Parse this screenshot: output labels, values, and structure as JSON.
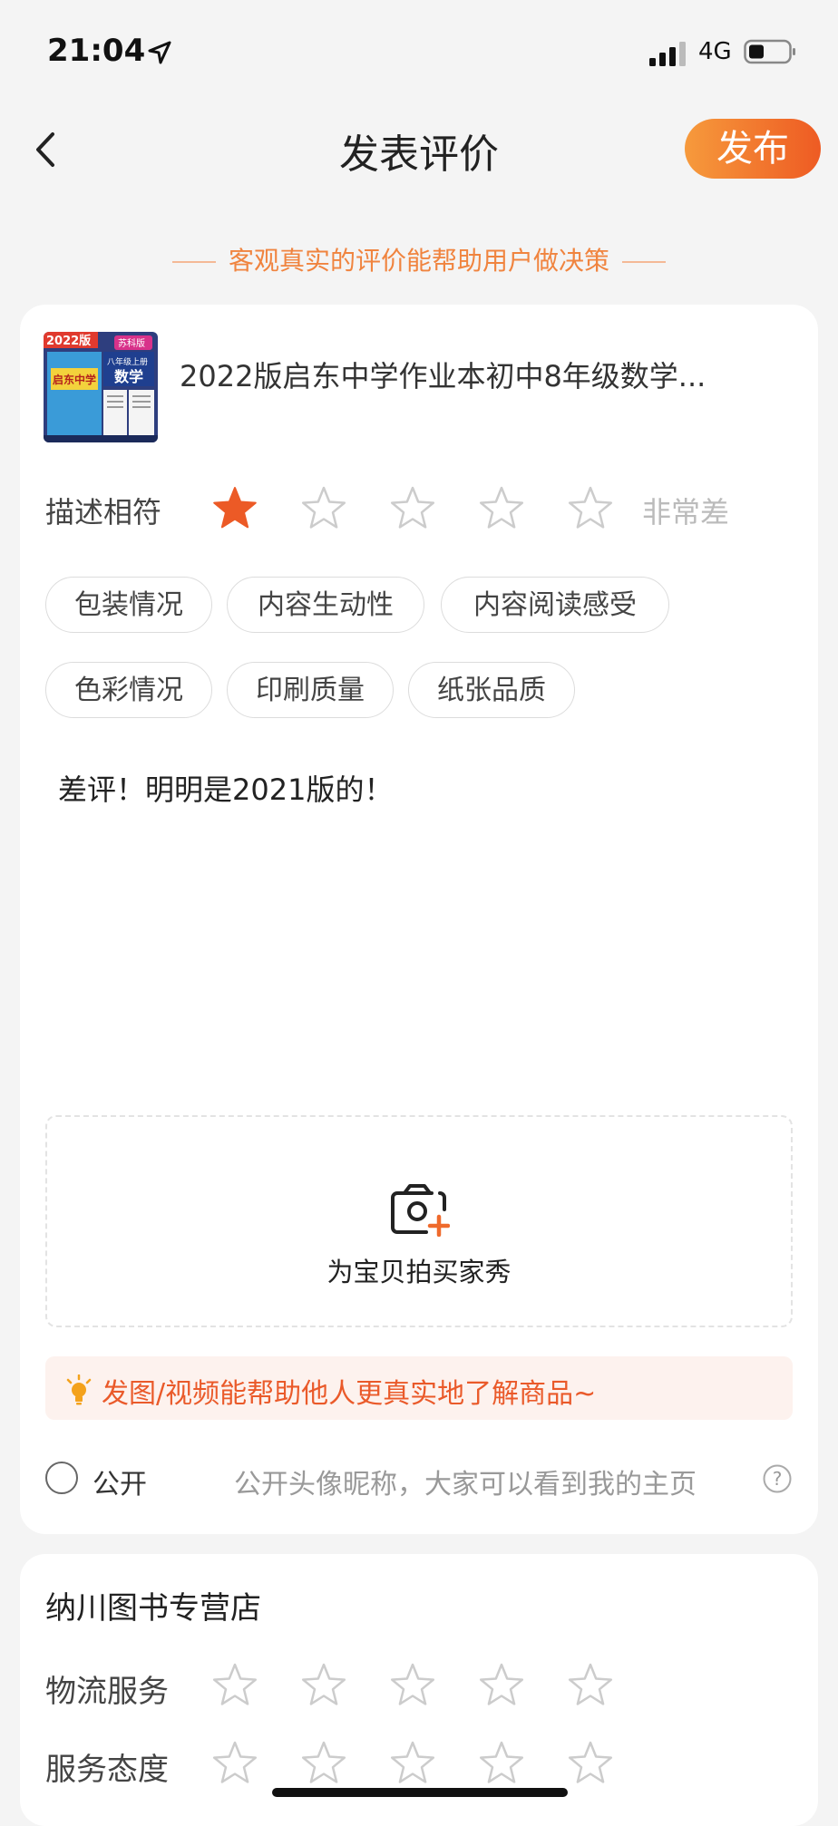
{
  "status_bar": {
    "time": "21:04",
    "network": "4G"
  },
  "header": {
    "title": "发表评价",
    "publish_label": "发布"
  },
  "tip": "客观真实的评价能帮助用户做决策",
  "product": {
    "title": "2022版启东中学作业本初中8年级数学...",
    "cover_texts": {
      "edition": "2022版",
      "version": "苏科版",
      "grade": "八年级上册",
      "subject": "数学",
      "brand": "启东中学"
    }
  },
  "rating": {
    "label": "描述相符",
    "value": 1,
    "max": 5,
    "text": "非常差"
  },
  "tags": [
    "包装情况",
    "内容生动性",
    "内容阅读感受",
    "色彩情况",
    "印刷质量",
    "纸张品质"
  ],
  "review_text": "差评！明明是2021版的！",
  "upload": {
    "label": "为宝贝拍买家秀"
  },
  "hint": "发图/视频能帮助他人更真实地了解商品~",
  "public": {
    "label": "公开",
    "desc": "公开头像昵称，大家可以看到我的主页"
  },
  "store": {
    "name": "纳川图书专营店",
    "ratings": [
      {
        "label": "物流服务",
        "value": 0
      },
      {
        "label": "服务态度",
        "value": 0
      }
    ]
  },
  "colors": {
    "accent": "#ee5b23",
    "star_filled": "#ec5a26",
    "star_empty": "#cccccc"
  }
}
